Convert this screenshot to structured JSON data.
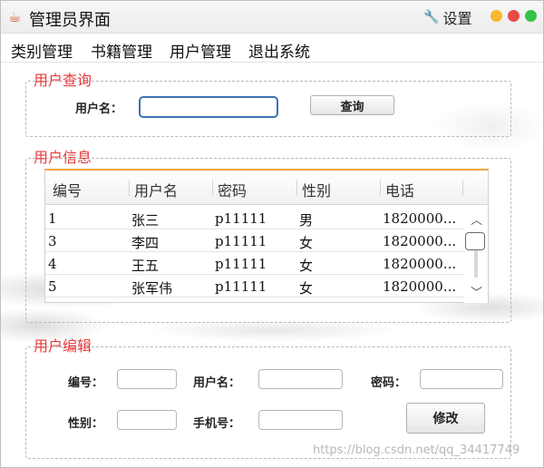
{
  "window": {
    "title": "管理员界面",
    "settings_label": "设置",
    "traffic_colors": [
      "#f5b82e",
      "#e84a4a",
      "#37c24a"
    ]
  },
  "menu": {
    "items": [
      {
        "label": "类别管理"
      },
      {
        "label": "书籍管理"
      },
      {
        "label": "用户管理"
      },
      {
        "label": "退出系统"
      }
    ]
  },
  "query": {
    "legend": "用户查询",
    "username_label": "用户名：",
    "username_value": "",
    "search_label": "查询"
  },
  "info": {
    "legend": "用户信息",
    "columns": [
      "编号",
      "用户名",
      "密码",
      "性别",
      "电话"
    ],
    "rows": [
      [
        "1",
        "张三",
        "p11111",
        "男",
        "1820000..."
      ],
      [
        "3",
        "李四",
        "p11111",
        "女",
        "1820000..."
      ],
      [
        "4",
        "王五",
        "p11111",
        "女",
        "1820000..."
      ],
      [
        "5",
        "张军伟",
        "p11111",
        "女",
        "1820000..."
      ]
    ]
  },
  "edit": {
    "legend": "用户编辑",
    "id_label": "编号：",
    "id_value": "",
    "username_label": "用户名：",
    "username_value": "",
    "password_label": "密码：",
    "password_value": "",
    "gender_label": "性别：",
    "gender_value": "",
    "phone_label": "手机号：",
    "phone_value": "",
    "modify_label": "修改"
  },
  "watermark": "https://blog.csdn.net/qq_34417749",
  "colors": {
    "legend_red": "#e53c3c",
    "header_accent": "#f0a43a",
    "focus_border": "#3b73b0"
  }
}
